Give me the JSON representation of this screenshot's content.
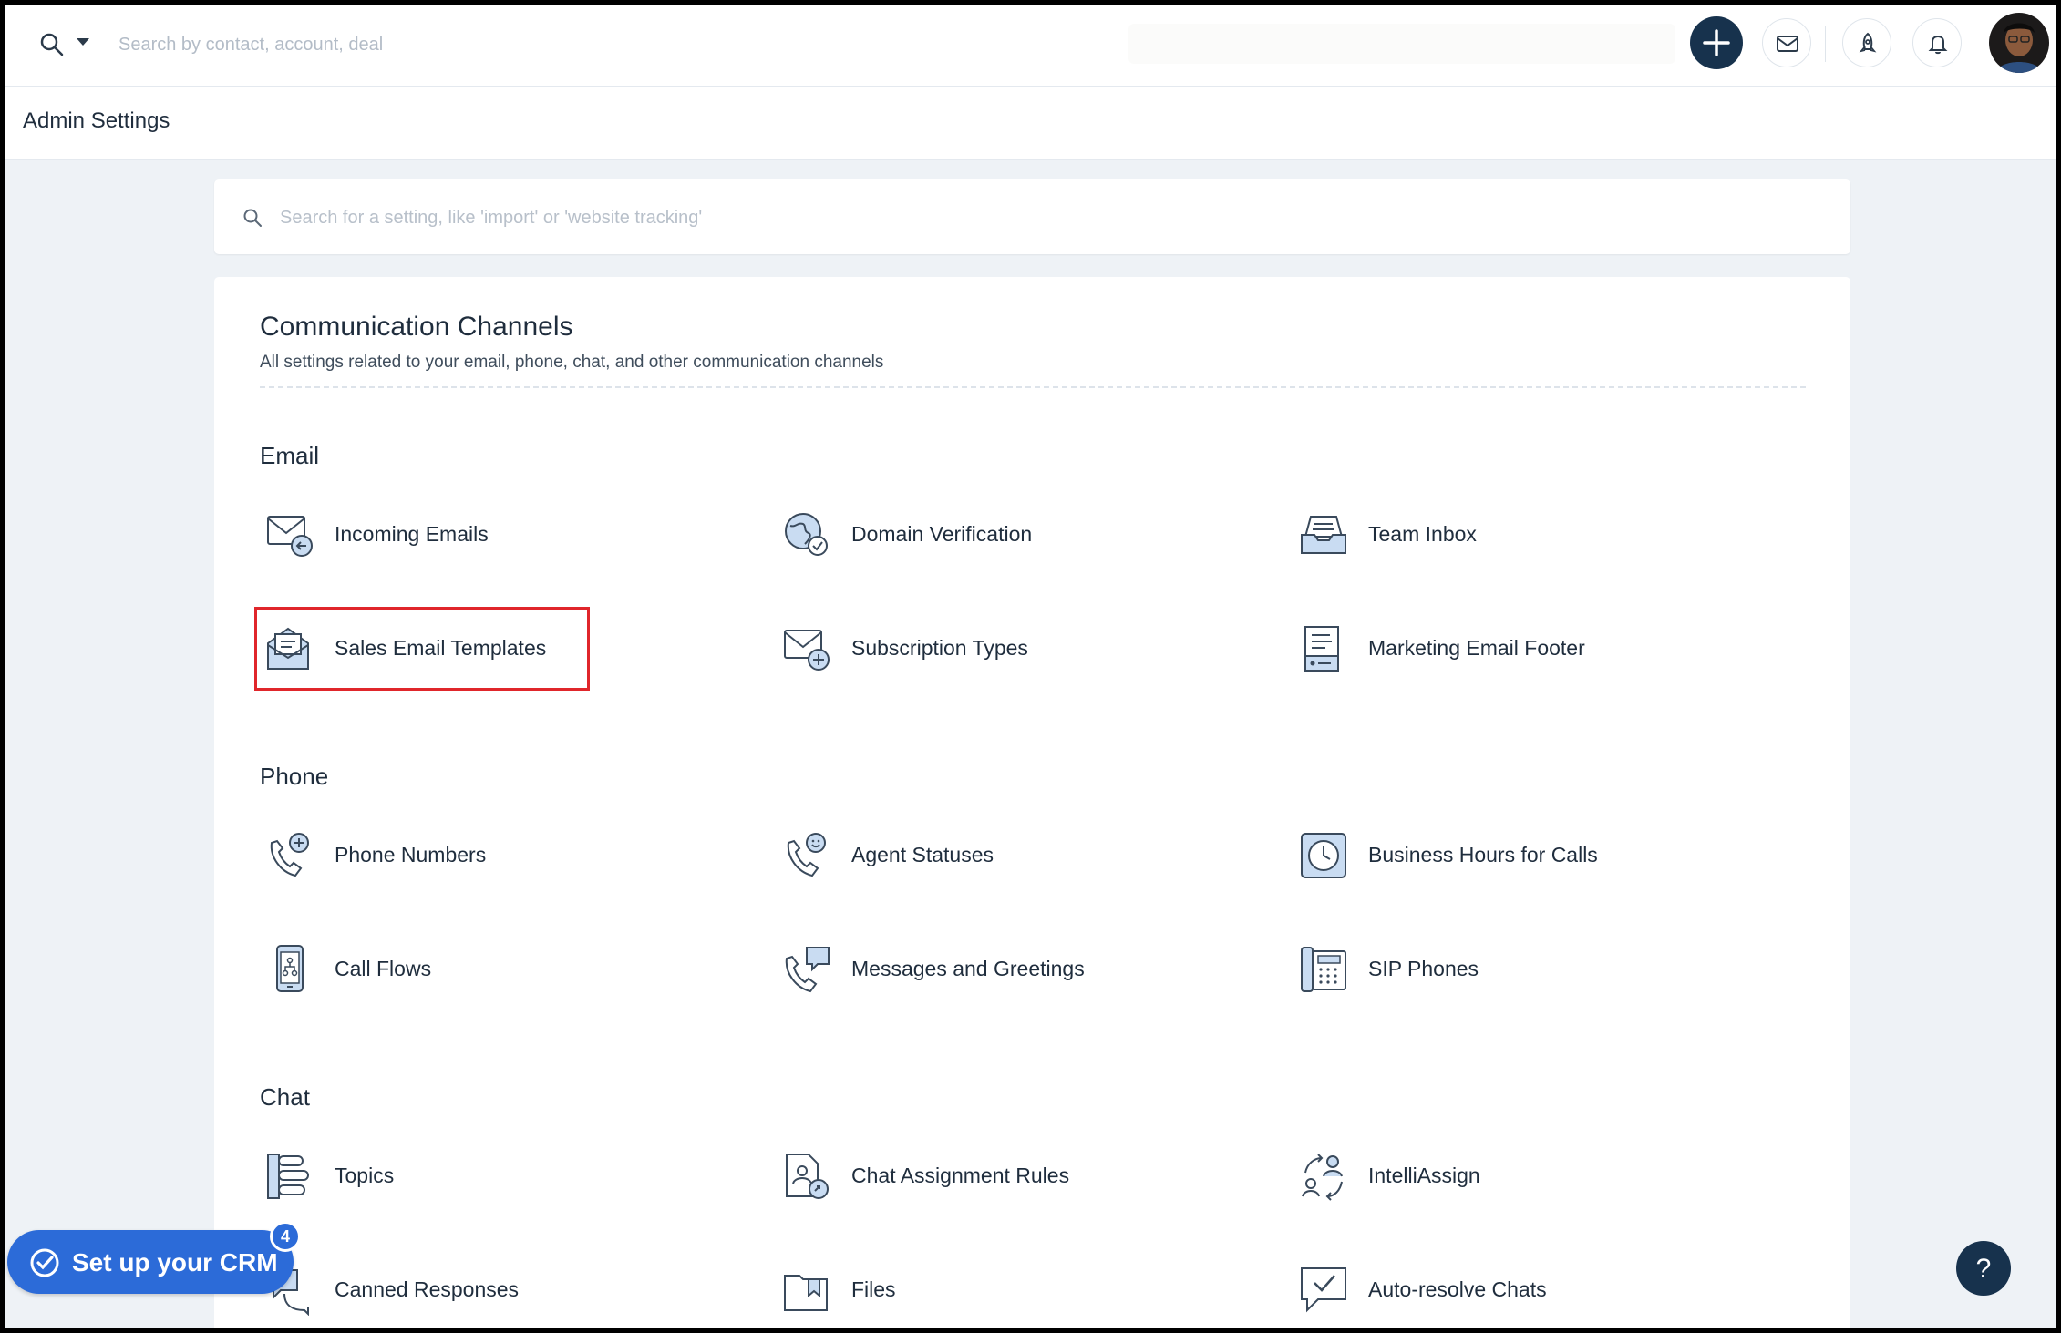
{
  "topbar": {
    "search_placeholder": "Search by contact, account, deal",
    "icons": [
      "search-icon",
      "chevron-down-icon",
      "plus-icon",
      "mail-icon",
      "rocket-icon",
      "bell-icon"
    ]
  },
  "page": {
    "title": "Admin Settings"
  },
  "settings_search": {
    "placeholder": "Search for a setting, like 'import' or 'website tracking'"
  },
  "card": {
    "title": "Communication Channels",
    "subtitle": "All settings related to your email, phone, chat, and other communication channels"
  },
  "sections": {
    "email": {
      "title": "Email",
      "items": [
        {
          "label": "Incoming Emails",
          "icon": "envelope-arrow-icon"
        },
        {
          "label": "Domain Verification",
          "icon": "globe-check-icon"
        },
        {
          "label": "Team Inbox",
          "icon": "inbox-tray-icon"
        },
        {
          "label": "Sales Email Templates",
          "icon": "open-envelope-icon"
        },
        {
          "label": "Subscription Types",
          "icon": "envelope-plus-icon"
        },
        {
          "label": "Marketing Email Footer",
          "icon": "document-footer-icon"
        }
      ]
    },
    "phone": {
      "title": "Phone",
      "items": [
        {
          "label": "Phone Numbers",
          "icon": "phone-plus-icon"
        },
        {
          "label": "Agent Statuses",
          "icon": "phone-smiley-icon"
        },
        {
          "label": "Business Hours for Calls",
          "icon": "clock-icon"
        },
        {
          "label": "Call Flows",
          "icon": "mobile-flow-icon"
        },
        {
          "label": "Messages and Greetings",
          "icon": "phone-chat-icon"
        },
        {
          "label": "SIP Phones",
          "icon": "desk-phone-icon"
        }
      ]
    },
    "chat": {
      "title": "Chat",
      "items": [
        {
          "label": "Topics",
          "icon": "topics-list-icon"
        },
        {
          "label": "Chat Assignment Rules",
          "icon": "document-user-icon"
        },
        {
          "label": "IntelliAssign",
          "icon": "users-cycle-icon"
        },
        {
          "label": "Canned Responses",
          "icon": "chat-bubbles-icon"
        },
        {
          "label": "Files",
          "icon": "folder-bookmark-icon"
        },
        {
          "label": "Auto-resolve Chats",
          "icon": "chat-check-icon"
        }
      ]
    }
  },
  "setup": {
    "label": "Set up your CRM",
    "badge": "4"
  },
  "help": {
    "label": "?"
  },
  "colors": {
    "accent": "#2c6bd8",
    "dark": "#17324d",
    "highlight": "#e0262b",
    "icon_fill": "#c9dcf2",
    "icon_stroke": "#3a4a5c"
  }
}
